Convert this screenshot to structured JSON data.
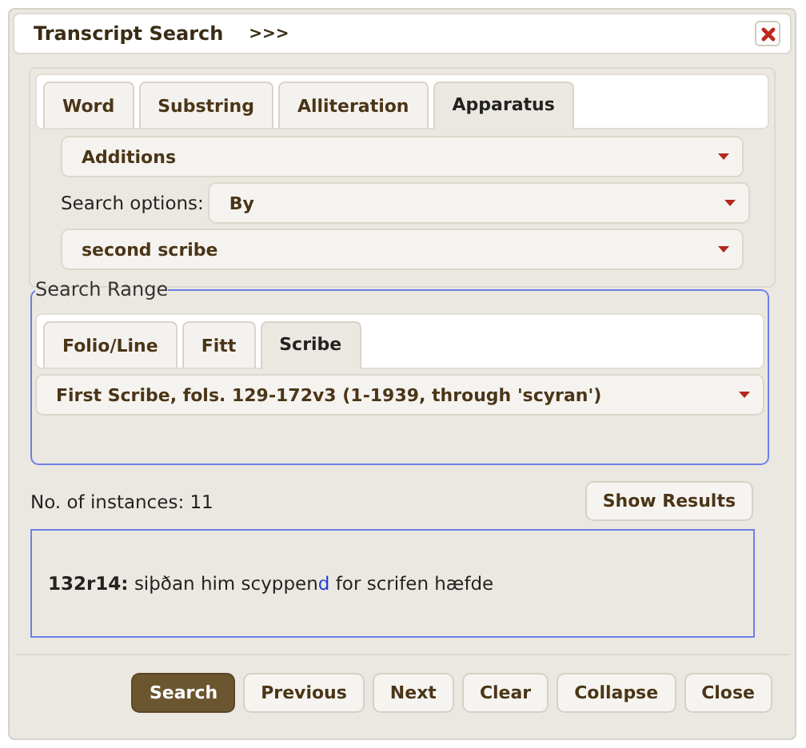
{
  "window": {
    "title": "Transcript Search",
    "expander": ">>>"
  },
  "tabs": [
    {
      "label": "Word",
      "selected": false
    },
    {
      "label": "Substring",
      "selected": false
    },
    {
      "label": "Alliteration",
      "selected": false
    },
    {
      "label": "Apparatus",
      "selected": true
    }
  ],
  "apparatus": {
    "type_select": "Additions",
    "options_label": "Search options:",
    "options_select": "By",
    "value_select": "second scribe"
  },
  "search_range": {
    "legend": "Search Range",
    "tabs": [
      {
        "label": "Folio/Line",
        "selected": false
      },
      {
        "label": "Fitt",
        "selected": false
      },
      {
        "label": "Scribe",
        "selected": true
      }
    ],
    "select": "First Scribe, fols. 129-172v3 (1-1939, through 'scyran')"
  },
  "instances": "No. of instances: 11",
  "show_results": "Show Results",
  "results": [
    {
      "line": "132r14:",
      "segments": [
        {
          "text": "siþðan him scyppen",
          "highlight": false
        },
        {
          "text": "d",
          "highlight": true
        },
        {
          "text": " for scrifen hæfde",
          "highlight": false
        }
      ]
    }
  ],
  "buttons": [
    {
      "label": "Search",
      "kind": "primary"
    },
    {
      "label": "Previous",
      "kind": "default"
    },
    {
      "label": "Next",
      "kind": "default"
    },
    {
      "label": "Clear",
      "kind": "default"
    },
    {
      "label": "Collapse",
      "kind": "default"
    },
    {
      "label": "Close",
      "kind": "default"
    }
  ]
}
